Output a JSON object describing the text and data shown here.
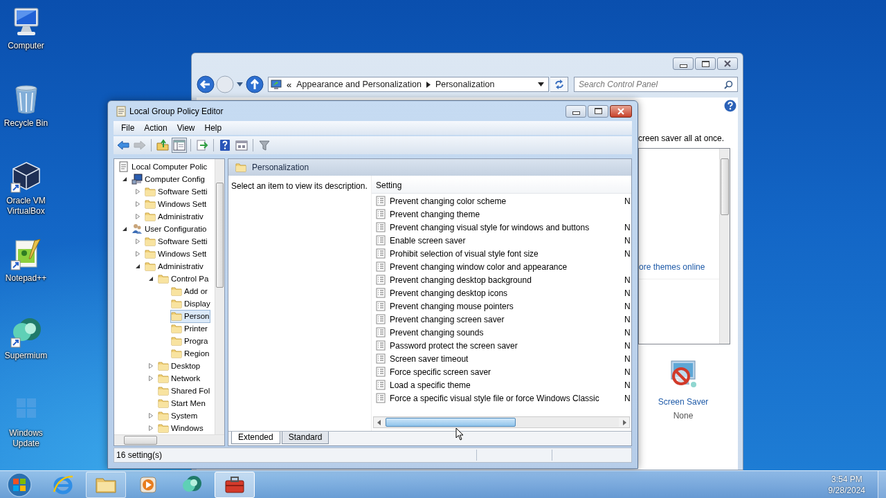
{
  "desktop_icons": [
    {
      "label": "Computer",
      "kind": "computer"
    },
    {
      "label": "Recycle Bin",
      "kind": "recycle-bin"
    },
    {
      "label": "Oracle VM VirtualBox",
      "kind": "virtualbox"
    },
    {
      "label": "Notepad++",
      "kind": "notepad"
    },
    {
      "label": "Supermium",
      "kind": "supermium"
    },
    {
      "label": "Windows Update",
      "kind": "windows-update"
    }
  ],
  "control_panel": {
    "breadcrumb_prefix": "«",
    "breadcrumb": [
      "Appearance and Personalization",
      "Personalization"
    ],
    "search": {
      "placeholder": "Search Control Panel"
    },
    "intro_text": "creen saver all at once.",
    "themes_link": "ore themes online",
    "screen_saver": {
      "label": "Screen Saver",
      "value": "None"
    }
  },
  "policy_editor": {
    "title": "Local Group Policy Editor",
    "menu": [
      "File",
      "Action",
      "View",
      "Help"
    ],
    "toolbar": [
      [
        {
          "kind": "back",
          "disabled": false,
          "pressed": false
        },
        {
          "kind": "forward",
          "disabled": true,
          "pressed": false
        }
      ],
      [
        {
          "kind": "up",
          "disabled": false,
          "pressed": false
        },
        {
          "kind": "tree",
          "disabled": false,
          "pressed": true
        }
      ],
      [
        {
          "kind": "export",
          "disabled": false,
          "pressed": false
        }
      ],
      [
        {
          "kind": "help",
          "disabled": false,
          "pressed": false
        },
        {
          "kind": "properties",
          "disabled": false,
          "pressed": false
        }
      ],
      [
        {
          "kind": "filter",
          "disabled": false,
          "pressed": false
        }
      ]
    ],
    "tree": [
      {
        "label": "Local Computer Polic",
        "kind": "policy",
        "selected": false,
        "children": [
          {
            "label": "Computer Config",
            "kind": "computer",
            "expanded": true,
            "selected": false,
            "children": [
              {
                "label": "Software Setti",
                "kind": "folder",
                "expanded": false,
                "selected": false
              },
              {
                "label": "Windows Sett",
                "kind": "folder",
                "expanded": false,
                "selected": false
              },
              {
                "label": "Administrativ",
                "kind": "folder",
                "expanded": false,
                "selected": false
              }
            ]
          },
          {
            "label": "User Configuratio",
            "kind": "user",
            "expanded": true,
            "selected": false,
            "children": [
              {
                "label": "Software Setti",
                "kind": "folder",
                "expanded": false,
                "selected": false
              },
              {
                "label": "Windows Sett",
                "kind": "folder",
                "expanded": false,
                "selected": false
              },
              {
                "label": "Administrativ",
                "kind": "folder",
                "expanded": true,
                "selected": false,
                "children": [
                  {
                    "label": "Control Pa",
                    "kind": "folder",
                    "expanded": true,
                    "selected": false,
                    "children": [
                      {
                        "label": "Add or",
                        "kind": "folder",
                        "selected": false
                      },
                      {
                        "label": "Display",
                        "kind": "folder",
                        "selected": false
                      },
                      {
                        "label": "Person",
                        "kind": "folder",
                        "selected": true
                      },
                      {
                        "label": "Printer",
                        "kind": "folder",
                        "selected": false
                      },
                      {
                        "label": "Progra",
                        "kind": "folder",
                        "selected": false
                      },
                      {
                        "label": "Region",
                        "kind": "folder",
                        "selected": false
                      }
                    ]
                  },
                  {
                    "label": "Desktop",
                    "kind": "folder",
                    "expanded": false,
                    "selected": false
                  },
                  {
                    "label": "Network",
                    "kind": "folder",
                    "expanded": false,
                    "selected": false
                  },
                  {
                    "label": "Shared Fol",
                    "kind": "folder",
                    "selected": false
                  },
                  {
                    "label": "Start Men",
                    "kind": "folder",
                    "selected": false
                  },
                  {
                    "label": "System",
                    "kind": "folder",
                    "expanded": false,
                    "selected": false
                  },
                  {
                    "label": "Windows",
                    "kind": "folder",
                    "expanded": false,
                    "selected": false
                  }
                ]
              }
            ]
          }
        ]
      }
    ],
    "header": "Personalization",
    "description": "Select an item to view its description.",
    "columns": [
      "Setting"
    ],
    "settings": [
      {
        "name": "Prevent changing color scheme",
        "column_2": "N"
      },
      {
        "name": "Prevent changing theme"
      },
      {
        "name": "Prevent changing visual style for windows and buttons",
        "column_2": "N"
      },
      {
        "name": "Enable screen saver",
        "column_2": "N"
      },
      {
        "name": "Prohibit selection of visual style font size",
        "column_2": "N"
      },
      {
        "name": "Prevent changing window color and appearance"
      },
      {
        "name": "Prevent changing desktop background",
        "column_2": "N"
      },
      {
        "name": "Prevent changing desktop icons",
        "column_2": "N"
      },
      {
        "name": "Prevent changing mouse pointers",
        "column_2": "N"
      },
      {
        "name": "Prevent changing screen saver",
        "column_2": "N"
      },
      {
        "name": "Prevent changing sounds",
        "column_2": "N"
      },
      {
        "name": "Password protect the screen saver",
        "column_2": "N"
      },
      {
        "name": "Screen saver timeout",
        "column_2": "N"
      },
      {
        "name": "Force specific screen saver",
        "column_2": "N"
      },
      {
        "name": "Load a specific theme",
        "column_2": "N"
      },
      {
        "name": "Force a specific visual style file or force Windows Classic",
        "column_2": "N"
      }
    ],
    "tabs": [
      {
        "label": "Extended",
        "selected": true
      },
      {
        "label": "Standard",
        "selected": false
      }
    ],
    "status": "16 setting(s)"
  },
  "taskbar": {
    "apps": [
      {
        "kind": "browser",
        "running": false,
        "active": false
      },
      {
        "kind": "explorer",
        "running": true,
        "active": false
      },
      {
        "kind": "media",
        "running": false,
        "active": false
      },
      {
        "kind": "supermium",
        "running": false,
        "active": false
      },
      {
        "kind": "toolbox",
        "running": true,
        "active": true
      }
    ],
    "clock": {
      "time": "3:54 PM",
      "date": "9/28/2024"
    }
  }
}
